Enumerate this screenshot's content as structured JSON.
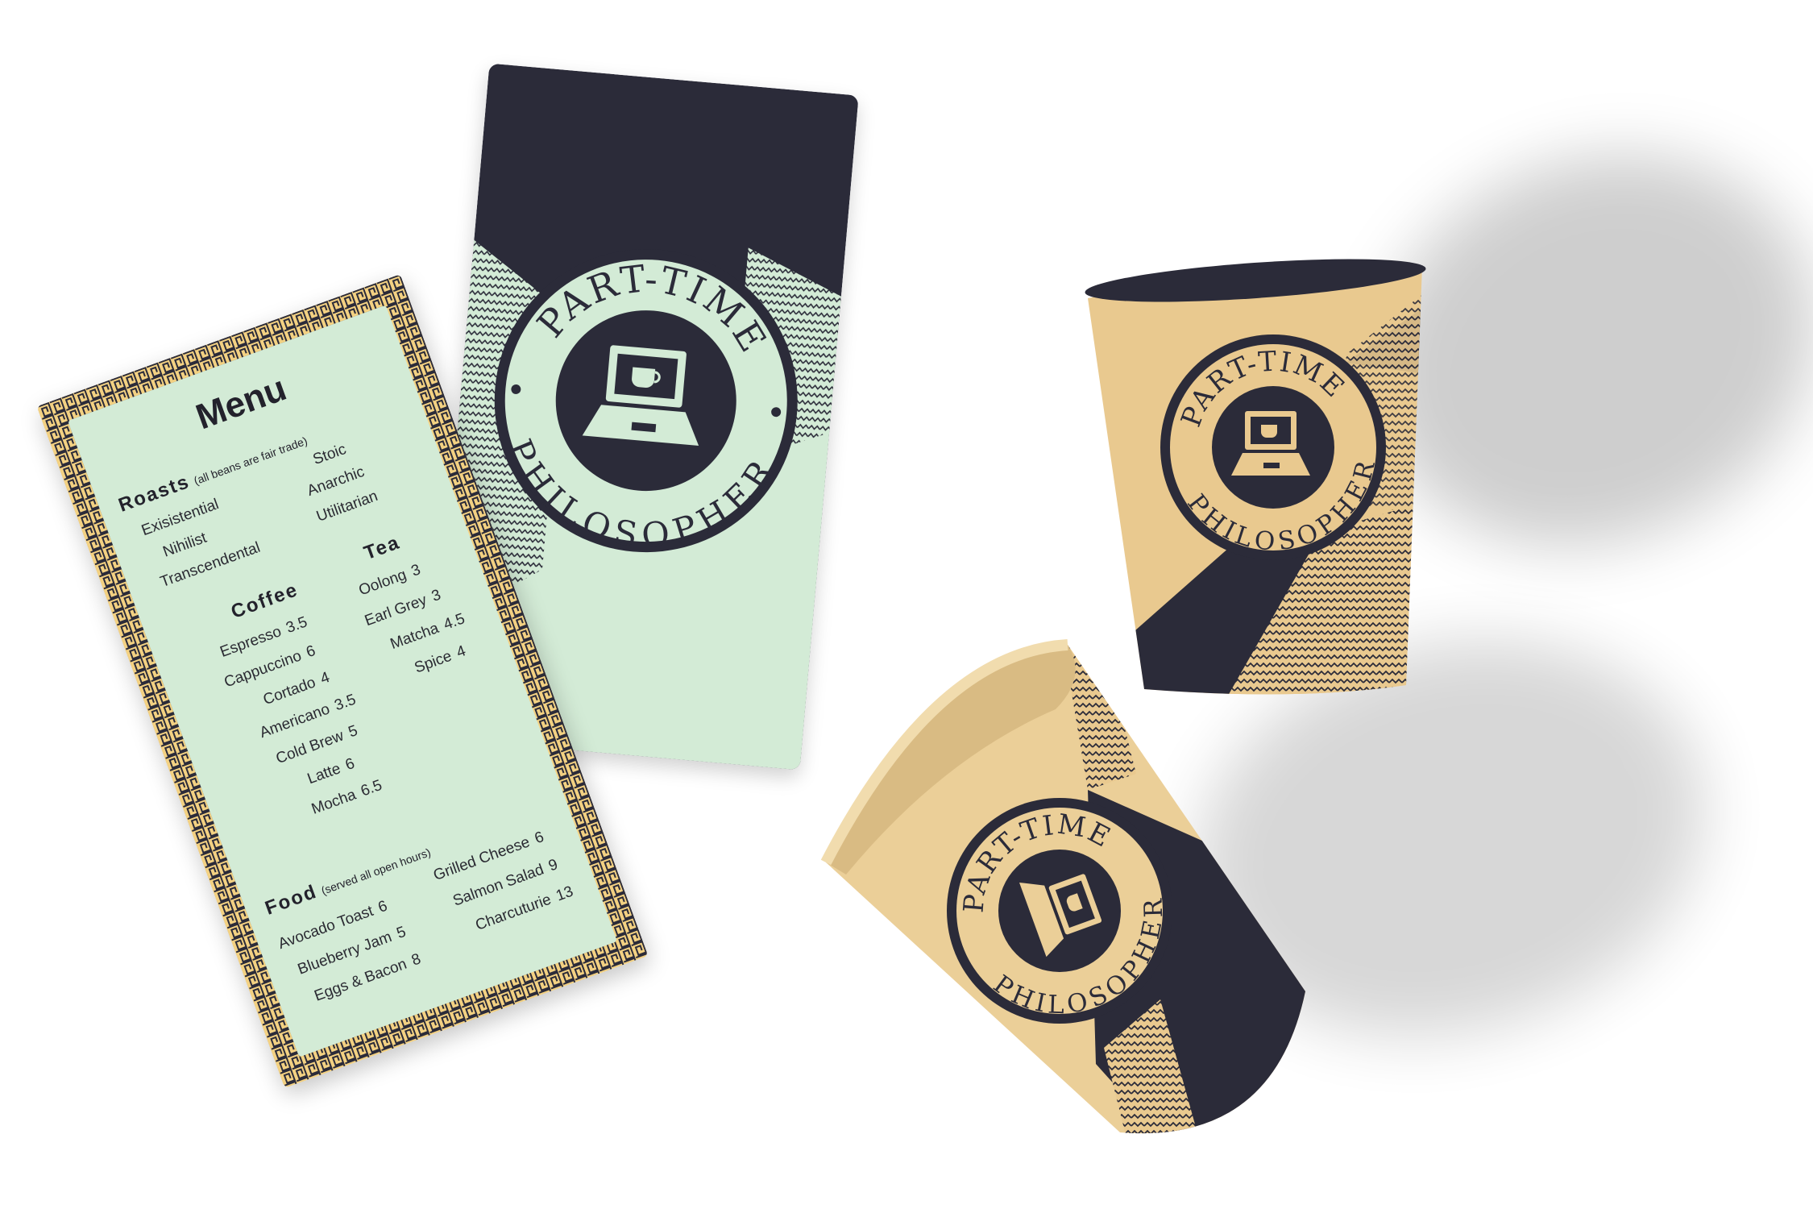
{
  "brand": {
    "name_top": "PART-TIME",
    "name_bottom": "PHILOSOPHER"
  },
  "icons": [
    "laptop-coffee-icon"
  ],
  "colors": {
    "navy": "#2b2b39",
    "mint": "#d3ebd6",
    "gold": "#f3d182",
    "kraft": "#e9c98f",
    "background": "#ffffff"
  },
  "menu": {
    "title": "Menu",
    "roasts": {
      "heading": "Roasts",
      "note": "(all beans are fair trade)",
      "items": [
        "Exisistential",
        "Nihilist",
        "Transcendental",
        "Stoic",
        "Anarchic",
        "Utilitarian"
      ]
    },
    "coffee": {
      "heading": "Coffee",
      "items": [
        {
          "name": "Espresso",
          "price": "3.5"
        },
        {
          "name": "Cappuccino",
          "price": "6"
        },
        {
          "name": "Cortado",
          "price": "4"
        },
        {
          "name": "Americano",
          "price": "3.5"
        },
        {
          "name": "Cold Brew",
          "price": "5"
        },
        {
          "name": "Latte",
          "price": "6"
        },
        {
          "name": "Mocha",
          "price": "6.5"
        }
      ]
    },
    "tea": {
      "heading": "Tea",
      "items": [
        {
          "name": "Oolong",
          "price": "3"
        },
        {
          "name": "Earl Grey",
          "price": "3"
        },
        {
          "name": "Matcha",
          "price": "4.5"
        },
        {
          "name": "Spice",
          "price": "4"
        }
      ]
    },
    "food": {
      "heading": "Food",
      "note": "(served all open hours)",
      "items": [
        {
          "name": "Avocado Toast",
          "price": "6"
        },
        {
          "name": "Blueberry Jam",
          "price": "5"
        },
        {
          "name": "Eggs & Bacon",
          "price": "8"
        },
        {
          "name": "Grilled Cheese",
          "price": "6"
        },
        {
          "name": "Salmon Salad",
          "price": "9"
        },
        {
          "name": "Charcuturie",
          "price": "13"
        }
      ]
    }
  }
}
